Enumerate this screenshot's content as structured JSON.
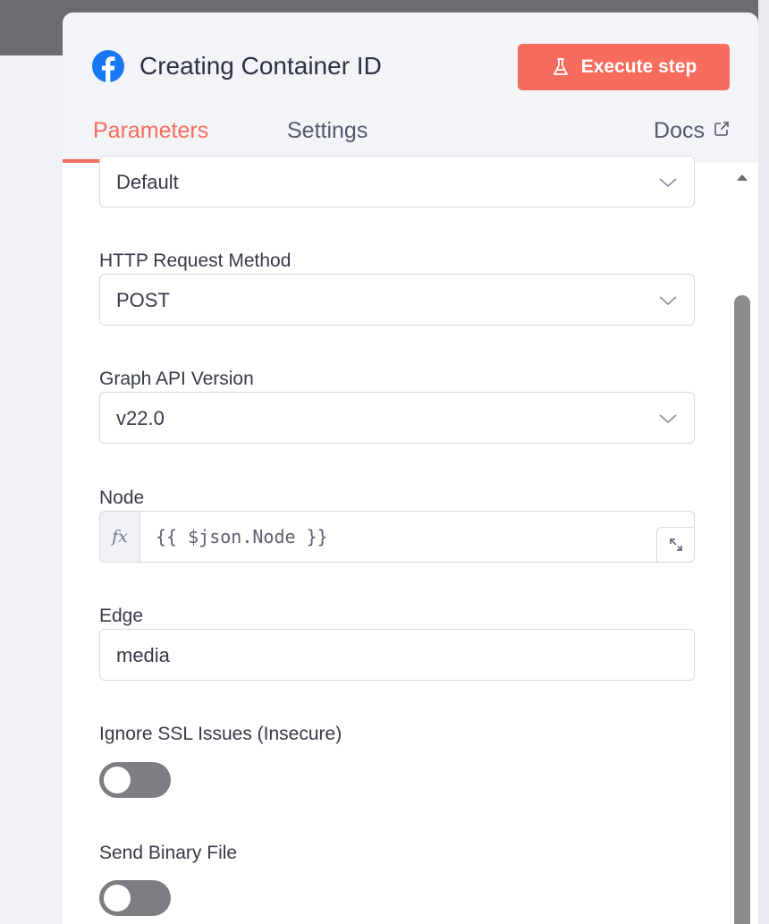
{
  "node": {
    "title": "Creating Container ID",
    "execute_label": "Execute step"
  },
  "tabs": {
    "parameters": "Parameters",
    "settings": "Settings",
    "docs": "Docs"
  },
  "fields": {
    "first_select": {
      "value": "Default"
    },
    "http_method": {
      "label": "HTTP Request Method",
      "value": "POST"
    },
    "graph_api_version": {
      "label": "Graph API Version",
      "value": "v22.0"
    },
    "node_field": {
      "label": "Node",
      "fx": "fx",
      "expression": "{{ $json.Node }}"
    },
    "edge": {
      "label": "Edge",
      "value": "media"
    },
    "ignore_ssl": {
      "label": "Ignore SSL Issues (Insecure)",
      "enabled": false
    },
    "send_binary": {
      "label": "Send Binary File",
      "enabled": false
    }
  },
  "colors": {
    "accent": "#f76c5c",
    "facebook": "#1877f2",
    "toggle_off": "#7d7e82"
  },
  "icons": {
    "node_icon": "facebook-icon",
    "execute_icon": "flask-icon",
    "docs_icon": "external-link-icon",
    "select_icon": "chevron-down-icon",
    "editor_icon": "open-editor-icon"
  }
}
